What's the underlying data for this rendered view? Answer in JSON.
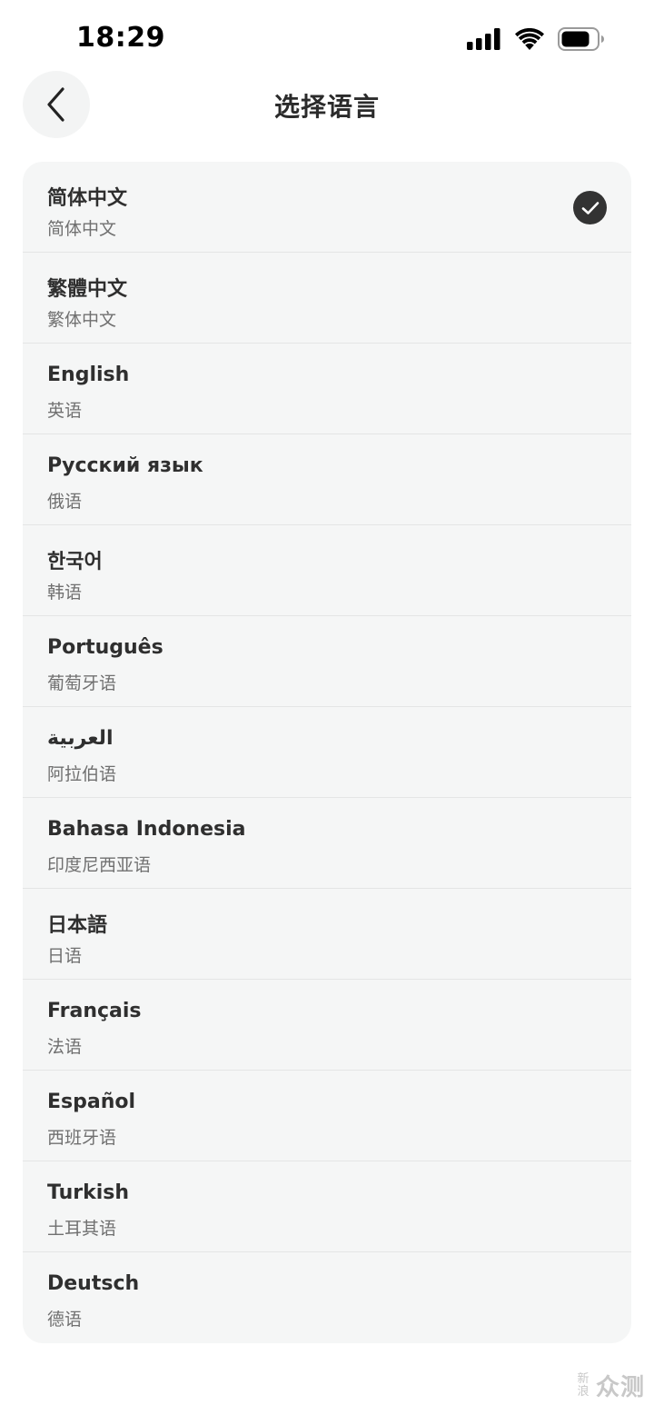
{
  "status_bar": {
    "time": "18:29",
    "icons": [
      "signal-icon",
      "wifi-icon",
      "battery-icon"
    ]
  },
  "header": {
    "title": "选择语言",
    "back_icon": "chevron-left-icon"
  },
  "languages": [
    {
      "native": "简体中文",
      "chinese": "简体中文",
      "selected": true
    },
    {
      "native": "繁體中文",
      "chinese": "繁体中文",
      "selected": false
    },
    {
      "native": "English",
      "chinese": "英语",
      "selected": false
    },
    {
      "native": "Русский язык",
      "chinese": "俄语",
      "selected": false
    },
    {
      "native": "한국어",
      "chinese": "韩语",
      "selected": false
    },
    {
      "native": "Português",
      "chinese": "葡萄牙语",
      "selected": false
    },
    {
      "native": "العربية",
      "chinese": "阿拉伯语",
      "selected": false
    },
    {
      "native": "Bahasa Indonesia",
      "chinese": "印度尼西亚语",
      "selected": false
    },
    {
      "native": "日本語",
      "chinese": "日语",
      "selected": false
    },
    {
      "native": "Français",
      "chinese": "法语",
      "selected": false
    },
    {
      "native": "Español",
      "chinese": "西班牙语",
      "selected": false
    },
    {
      "native": "Turkish",
      "chinese": "土耳其语",
      "selected": false
    },
    {
      "native": "Deutsch",
      "chinese": "德语",
      "selected": false
    }
  ],
  "watermark": {
    "small": "新浪",
    "big": "众测"
  },
  "colors": {
    "list_background": "#f5f6f6",
    "divider": "#e4e5e5",
    "check_fill": "#333333",
    "back_button_bg": "#f3f4f4"
  }
}
